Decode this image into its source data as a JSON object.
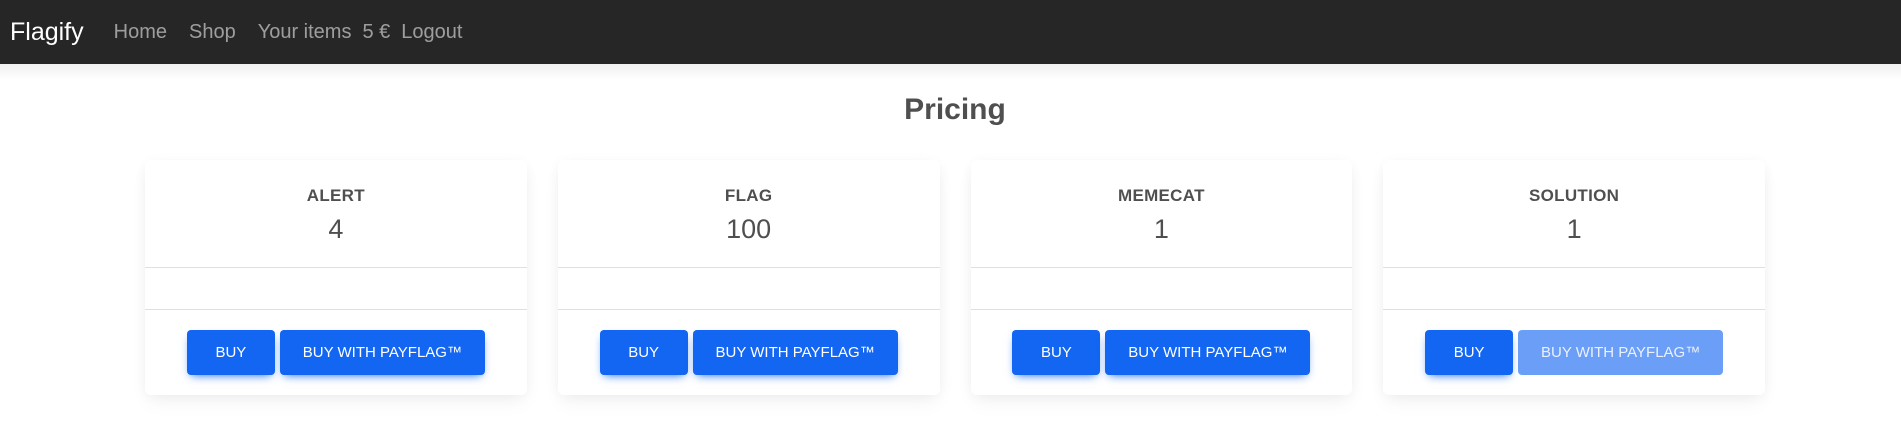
{
  "navbar": {
    "brand": "Flagify",
    "links": [
      "Home",
      "Shop",
      "Your items"
    ],
    "balance": "5 €",
    "logout": "Logout"
  },
  "page": {
    "title": "Pricing"
  },
  "products": [
    {
      "name": "ALERT",
      "value": "4",
      "buy_label": "BUY",
      "payflag_label": "BUY WITH PAYFLAG™",
      "payflag_enabled": true
    },
    {
      "name": "FLAG",
      "value": "100",
      "buy_label": "BUY",
      "payflag_label": "BUY WITH PAYFLAG™",
      "payflag_enabled": true
    },
    {
      "name": "MEMECAT",
      "value": "1",
      "buy_label": "BUY",
      "payflag_label": "BUY WITH PAYFLAG™",
      "payflag_enabled": true
    },
    {
      "name": "SOLUTION",
      "value": "1",
      "buy_label": "BUY",
      "payflag_label": "BUY WITH PAYFLAG™",
      "payflag_enabled": false
    }
  ],
  "colors": {
    "navbar_bg": "#262626",
    "primary": "#1266f1",
    "primary_disabled": "#6b9ef6",
    "text": "#4f4f4f"
  }
}
